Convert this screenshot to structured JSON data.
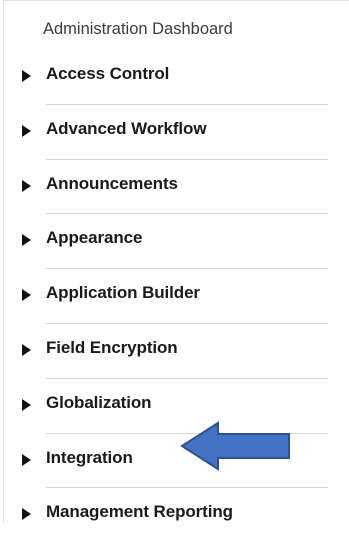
{
  "panel": {
    "title": "Administration Dashboard"
  },
  "menu": {
    "items": [
      {
        "label": "Access Control",
        "icon": "caret-right-icon"
      },
      {
        "label": "Advanced Workflow",
        "icon": "caret-right-icon"
      },
      {
        "label": "Announcements",
        "icon": "caret-right-icon"
      },
      {
        "label": "Appearance",
        "icon": "caret-right-icon"
      },
      {
        "label": "Application Builder",
        "icon": "caret-right-icon"
      },
      {
        "label": "Field Encryption",
        "icon": "caret-right-icon"
      },
      {
        "label": "Globalization",
        "icon": "caret-right-icon"
      },
      {
        "label": "Integration",
        "icon": "caret-right-icon"
      },
      {
        "label": "Management Reporting",
        "icon": "caret-right-icon"
      }
    ]
  },
  "annotation": {
    "icon": "left-arrow-icon",
    "target": "Integration",
    "fill_color": "#4472c4",
    "stroke_color": "#2f528f"
  },
  "colors": {
    "caret": "#111111",
    "text": "#1a1a1a",
    "divider": "#d9d9d9"
  }
}
